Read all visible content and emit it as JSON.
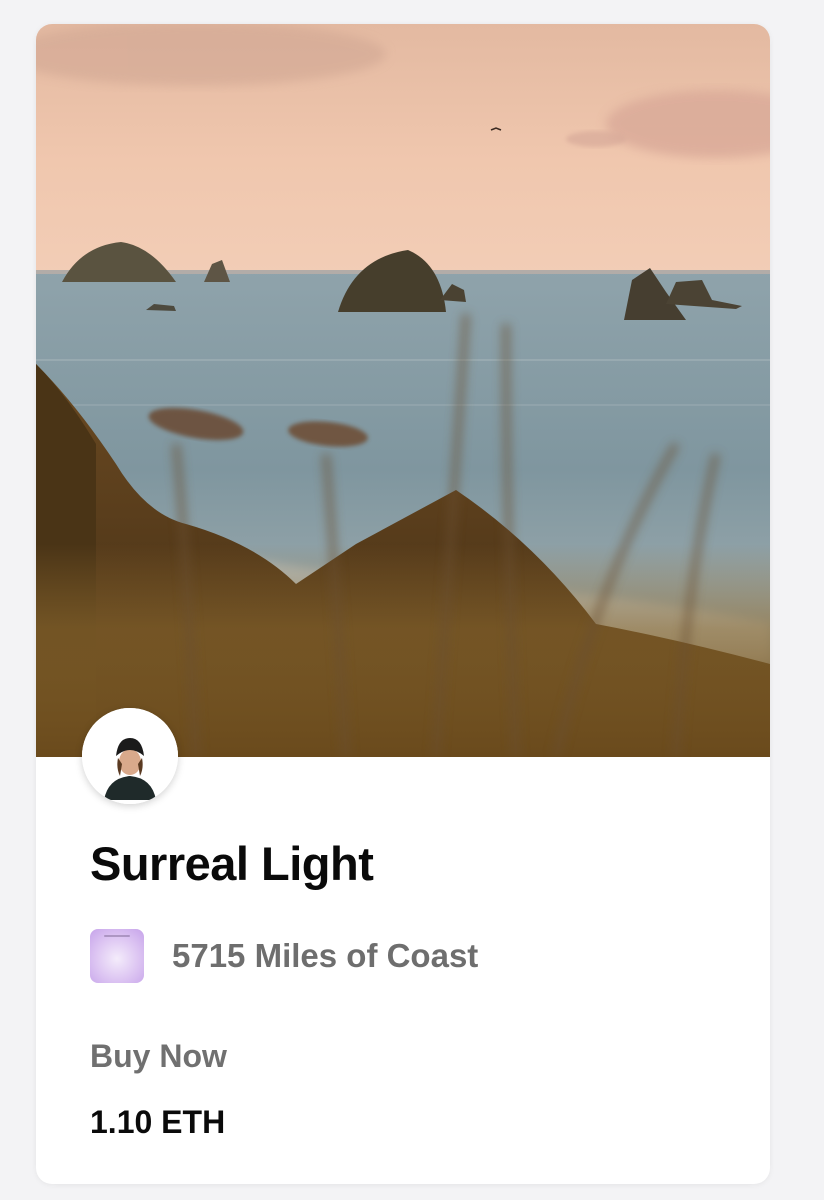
{
  "card": {
    "artwork": {
      "description_icon": "coastline-artwork-image"
    },
    "creator_avatar": {
      "icon": "creator-avatar"
    },
    "title": "Surreal Light",
    "collection": {
      "icon": "collection-thumbnail",
      "name": "5715 Miles of Coast"
    },
    "sale": {
      "label": "Buy Now",
      "price": "1.10 ETH"
    }
  },
  "colors": {
    "page_background": "#f3f3f5",
    "card_background": "#ffffff",
    "title_text": "#0a0a0a",
    "muted_text": "#6e6e6e",
    "collection_accent": "#d9c1f0"
  }
}
